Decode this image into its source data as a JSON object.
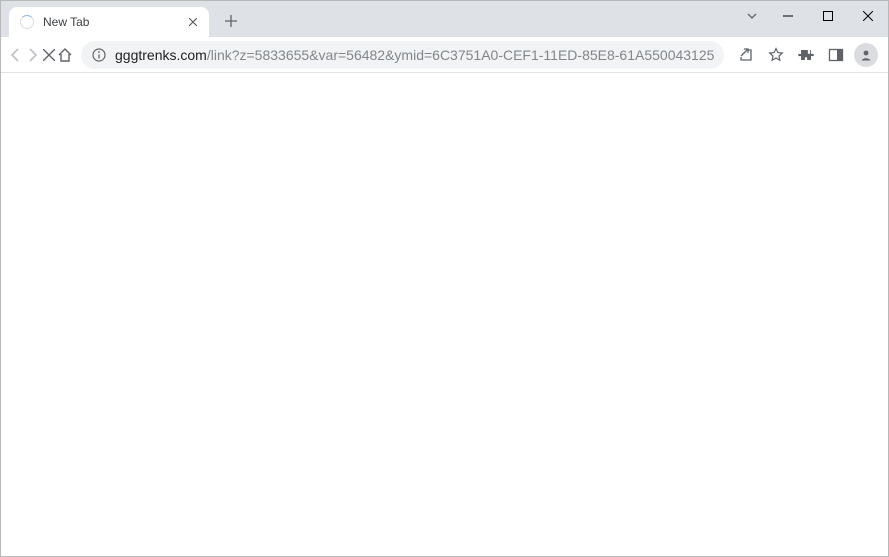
{
  "tab": {
    "title": "New Tab"
  },
  "omnibox": {
    "host": "gggtrenks.com",
    "path": "/link?z=5833655&var=56482&ymid=6C3751A0-CEF1-11ED-85E8-61A550043125"
  }
}
